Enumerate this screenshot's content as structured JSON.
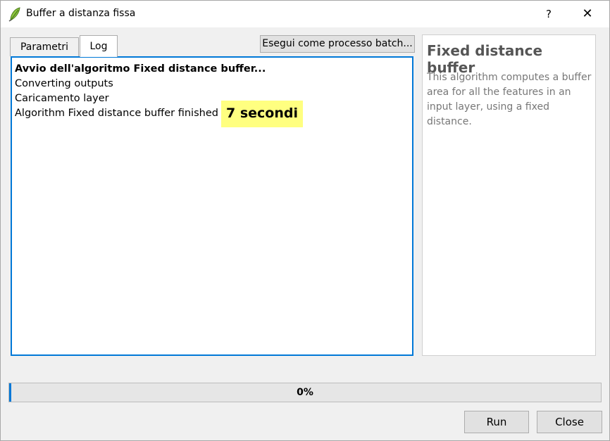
{
  "window": {
    "title": "Buffer a distanza fissa",
    "help_label": "?",
    "close_label": "✕"
  },
  "tabs": [
    {
      "label": "Parametri"
    },
    {
      "label": "Log"
    }
  ],
  "toolbar": {
    "batch_label": "Esegui come processo batch..."
  },
  "log": {
    "lines": [
      "Avvio dell'algoritmo Fixed distance buffer...",
      "Converting outputs",
      "Caricamento layer",
      "Algorithm Fixed distance buffer finished"
    ],
    "annotation": "7 secondi"
  },
  "help": {
    "title": "Fixed distance buffer",
    "description": "This algorithm computes a buffer area for all the features in an input layer, using a fixed distance."
  },
  "progress": {
    "value": 0.0,
    "label": "0%"
  },
  "buttons": {
    "run_label": "Run",
    "close_label": "Close"
  },
  "colors": {
    "accent": "#0078d7",
    "highlight": "#ffff80"
  },
  "icons": {
    "app": "qgis-leaf-icon"
  }
}
